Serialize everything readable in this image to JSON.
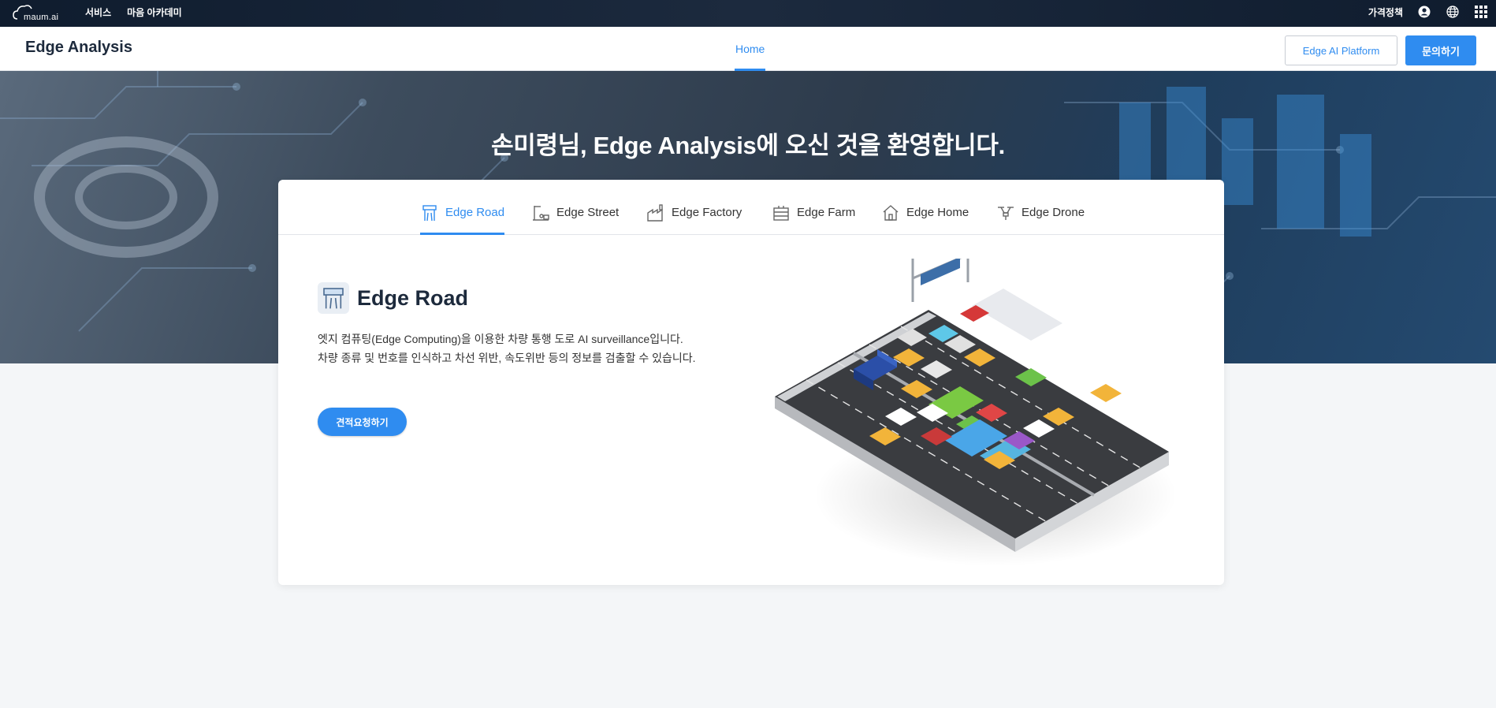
{
  "global_bar": {
    "logo_text": "maum.ai",
    "nav": [
      "서비스",
      "마음 아카데미"
    ],
    "pricing": "가격정책",
    "icons": [
      "user-icon",
      "globe-icon",
      "apps-grid-icon"
    ]
  },
  "header": {
    "title": "Edge Analysis",
    "nav_home": "Home",
    "platform_button": "Edge AI Platform",
    "contact_button": "문의하기"
  },
  "hero": {
    "welcome": "손미령님, Edge Analysis에 오신 것을 환영합니다."
  },
  "tabs": [
    {
      "label": "Edge Road",
      "icon": "road-gate-icon",
      "active": true
    },
    {
      "label": "Edge Street",
      "icon": "street-icon",
      "active": false
    },
    {
      "label": "Edge Factory",
      "icon": "factory-icon",
      "active": false
    },
    {
      "label": "Edge Farm",
      "icon": "farm-icon",
      "active": false
    },
    {
      "label": "Edge Home",
      "icon": "home-icon",
      "active": false
    },
    {
      "label": "Edge Drone",
      "icon": "drone-icon",
      "active": false
    }
  ],
  "content": {
    "title": "Edge Road",
    "desc_line1": "엣지 컴퓨팅(Edge Computing)을 이용한 차량 통행 도로 AI surveillance입니다.",
    "desc_line2": "차량 종류 및 번호를 인식하고 차선 위반, 속도위반 등의 정보를 검출할 수 있습니다.",
    "quote_button": "견적요청하기"
  },
  "colors": {
    "accent": "#2f8cf0",
    "topbar": "#15233a"
  }
}
